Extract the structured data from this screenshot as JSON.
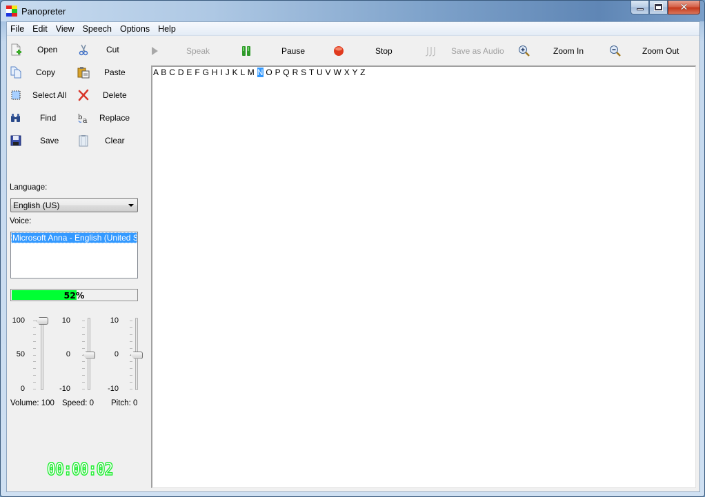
{
  "window": {
    "title": "Panopreter",
    "controls": {
      "minimize": "—",
      "maximize": "□",
      "close": "✕"
    }
  },
  "menu": [
    "File",
    "Edit",
    "View",
    "Speech",
    "Options",
    "Help"
  ],
  "edit_buttons": [
    {
      "label": "Open",
      "icon": "open-file-icon"
    },
    {
      "label": "Cut",
      "icon": "scissors-icon"
    },
    {
      "label": "Copy",
      "icon": "copy-icon"
    },
    {
      "label": "Paste",
      "icon": "paste-icon"
    },
    {
      "label": "Select All",
      "icon": "select-all-icon"
    },
    {
      "label": "Delete",
      "icon": "delete-x-icon"
    },
    {
      "label": "Find",
      "icon": "binoculars-icon"
    },
    {
      "label": "Replace",
      "icon": "replace-icon"
    },
    {
      "label": "Save",
      "icon": "floppy-disk-icon"
    },
    {
      "label": "Clear",
      "icon": "clipboard-clear-icon"
    }
  ],
  "toolbar": {
    "speak": {
      "label": "Speak",
      "enabled": false
    },
    "pause": {
      "label": "Pause",
      "enabled": true
    },
    "stop": {
      "label": "Stop",
      "enabled": true
    },
    "save_audio": {
      "label": "Save as Audio",
      "enabled": false
    },
    "zoom_in": {
      "label": "Zoom In",
      "enabled": true
    },
    "zoom_out": {
      "label": "Zoom Out",
      "enabled": true
    }
  },
  "language": {
    "label": "Language:",
    "selected": "English (US)"
  },
  "voice": {
    "label": "Voice:",
    "options": [
      "Microsoft Anna - English (United States)"
    ],
    "selected": "Microsoft Anna - English (United States)"
  },
  "progress": {
    "percent": 52,
    "text": "52%"
  },
  "sliders": {
    "volume": {
      "max_label": "100",
      "mid_label": "50",
      "min_label": "0",
      "min": 0,
      "max": 100,
      "value": 100,
      "caption": "Volume: 100"
    },
    "speed": {
      "max_label": "10",
      "mid_label": "0",
      "min_label": "-10",
      "min": -10,
      "max": 10,
      "value": 0,
      "caption": "Speed: 0"
    },
    "pitch": {
      "max_label": "10",
      "mid_label": "0",
      "min_label": "-10",
      "min": -10,
      "max": 10,
      "value": 0,
      "caption": "Pitch: 0"
    }
  },
  "timer": "00:00:02",
  "editor": {
    "text_before": "A B C D E F G H I J K L M ",
    "highlighted": "N",
    "text_after": " O P Q R S T U V W X Y Z"
  },
  "colors": {
    "progress_fill": "#00ff33",
    "timer": "#22ee33",
    "selection": "#3399ff"
  }
}
